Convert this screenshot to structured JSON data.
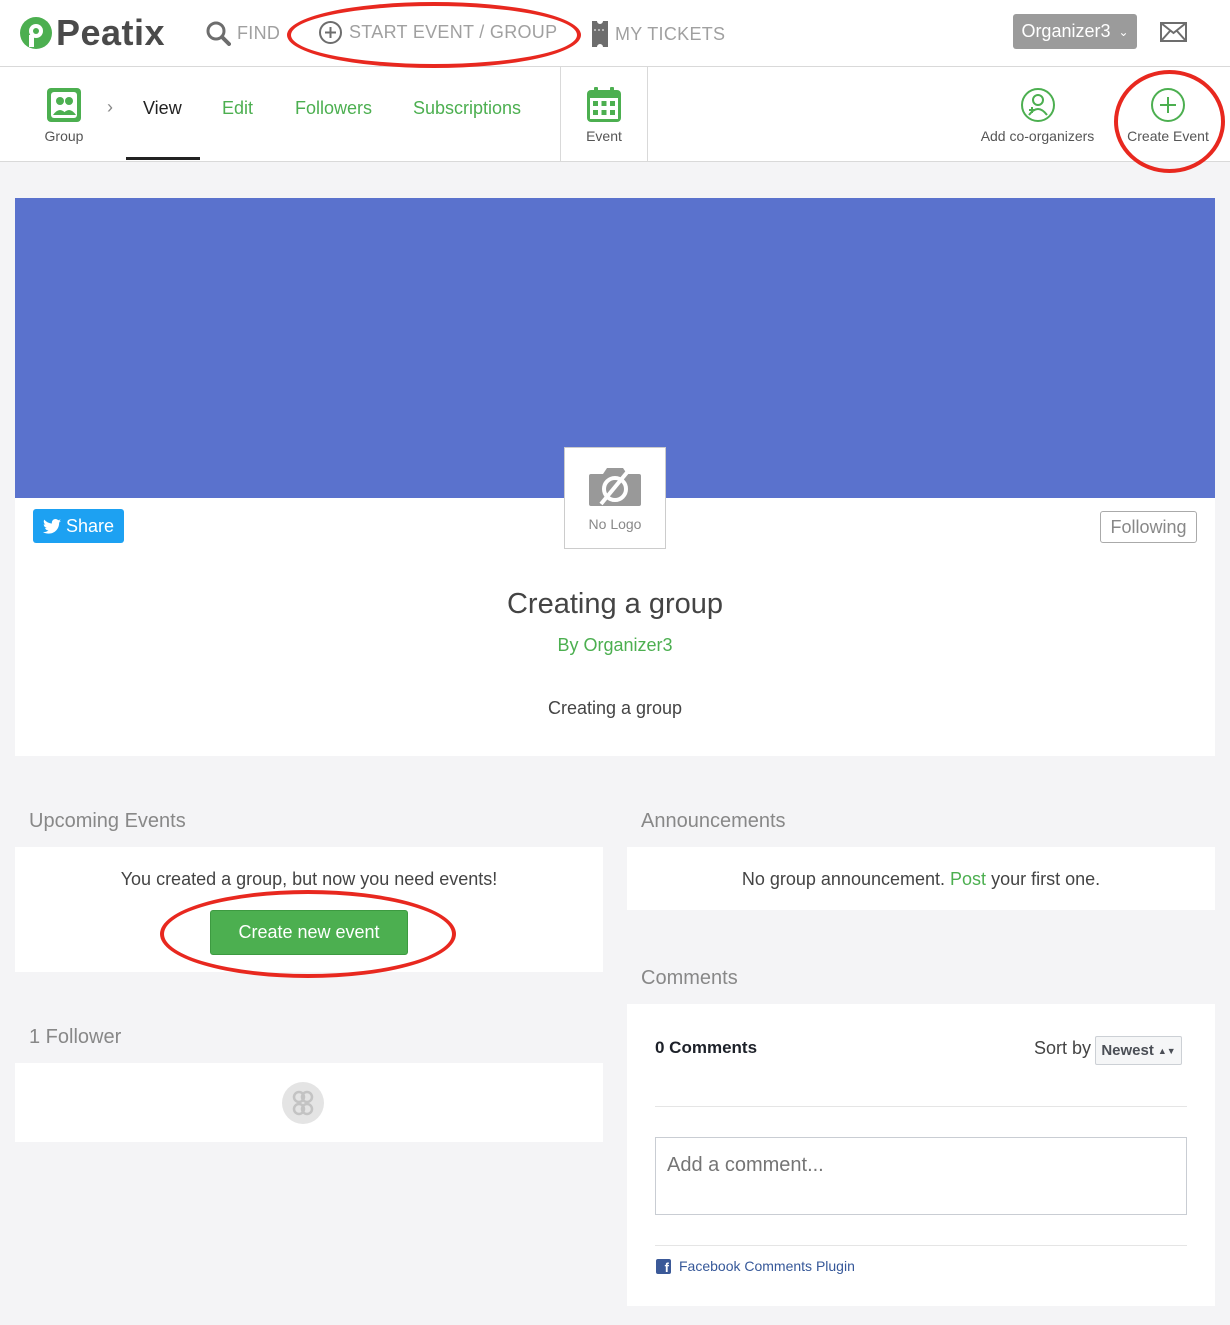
{
  "brand": {
    "name": "Peatix",
    "color": "#4caf50"
  },
  "topnav": {
    "find": "FIND",
    "start": "START EVENT / GROUP",
    "tickets": "MY TICKETS",
    "user": "Organizer3"
  },
  "subnav": {
    "group_tile": "Group",
    "tabs": {
      "view": "View",
      "edit": "Edit",
      "followers": "Followers",
      "subscriptions": "Subscriptions"
    },
    "event_tile": "Event",
    "add_coorganizers": "Add co-organizers",
    "create_event": "Create Event"
  },
  "group": {
    "cover_color": "#5a72cd",
    "logo_caption": "No Logo",
    "share": "Share",
    "following": "Following",
    "title": "Creating a group",
    "by": "By Organizer3",
    "description": "Creating a group"
  },
  "upcoming": {
    "heading": "Upcoming Events",
    "message": "You created a group, but now you need events!",
    "button": "Create new event"
  },
  "followers": {
    "heading": "1 Follower"
  },
  "announcements": {
    "heading": "Announcements",
    "msg_before": "No group announcement.",
    "link": "Post",
    "msg_after": "your first one."
  },
  "comments": {
    "heading": "Comments",
    "count": "0 Comments",
    "sort_label": "Sort by",
    "sort_value": "Newest",
    "placeholder": "Add a comment...",
    "plugin": "Facebook Comments Plugin"
  }
}
